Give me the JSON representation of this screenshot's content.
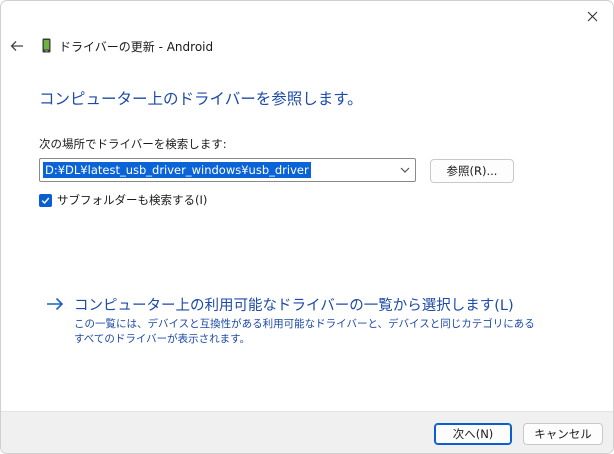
{
  "window": {
    "title": "ドライバーの更新 - Android",
    "close_icon": "close-icon",
    "back_icon": "back-arrow-icon",
    "device_icon": "phone-icon"
  },
  "heading": "コンピューター上のドライバーを参照します。",
  "search": {
    "label": "次の場所でドライバーを検索します:",
    "path_value": "D:¥DL¥latest_usb_driver_windows¥usb_driver",
    "browse_label": "参照(R)..."
  },
  "subfolders": {
    "checked": true,
    "label": "サブフォルダーも検索する(I)"
  },
  "pick_option": {
    "label": "コンピューター上の利用可能なドライバーの一覧から選択します(L)",
    "description": "この一覧には、デバイスと互換性がある利用可能なドライバーと、デバイスと同じカテゴリにあるすべてのドライバーが表示されます。"
  },
  "footer": {
    "next_label": "次へ(N)",
    "cancel_label": "キャンセル"
  },
  "colors": {
    "accent": "#0a5fd0",
    "link": "#1c4aa8",
    "selection": "#0a64d8"
  }
}
